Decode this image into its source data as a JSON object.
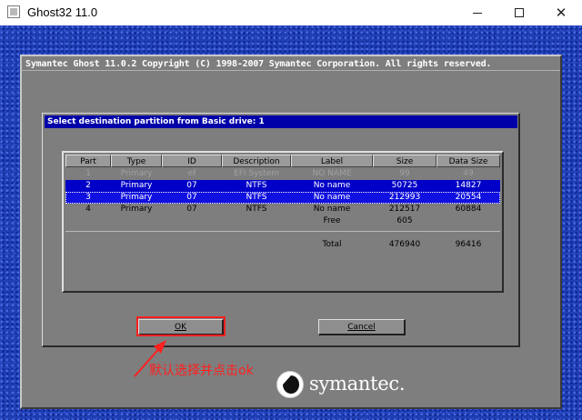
{
  "window": {
    "title": "Ghost32 11.0"
  },
  "ghost": {
    "header": "Symantec Ghost 11.0.2  Copyright (C) 1998-2007 Symantec Corporation. All rights reserved."
  },
  "dialog": {
    "title": "Select destination partition from Basic drive: 1",
    "columns": [
      "Part",
      "Type",
      "ID",
      "Description",
      "Label",
      "Size",
      "Data Size"
    ],
    "rows": [
      {
        "part": "1",
        "type": "Primary",
        "id": "ef",
        "description": "EFI System",
        "label": "NO NAME",
        "size": "99",
        "data_size": "49",
        "state": "disabled"
      },
      {
        "part": "2",
        "type": "Primary",
        "id": "07",
        "description": "NTFS",
        "label": "No name",
        "size": "50725",
        "data_size": "14827",
        "state": "selected"
      },
      {
        "part": "3",
        "type": "Primary",
        "id": "07",
        "description": "NTFS",
        "label": "No name",
        "size": "212993",
        "data_size": "20554",
        "state": "focused"
      },
      {
        "part": "4",
        "type": "Primary",
        "id": "07",
        "description": "NTFS",
        "label": "No name",
        "size": "212517",
        "data_size": "60884",
        "state": "normal"
      }
    ],
    "free": {
      "label": "Free",
      "size": "605"
    },
    "total": {
      "label": "Total",
      "size": "476940",
      "data_size": "96416"
    },
    "ok_label": "OK",
    "cancel_label": "Cancel"
  },
  "annotation": {
    "text": "默认选择并点击ok",
    "color": "#ff2020"
  },
  "logo": {
    "text": "symantec."
  },
  "colors": {
    "desktop": "#1f3fb5",
    "panel": "#7e7e7e",
    "title_bar": "#0000a8",
    "selection": "#0000c8"
  }
}
